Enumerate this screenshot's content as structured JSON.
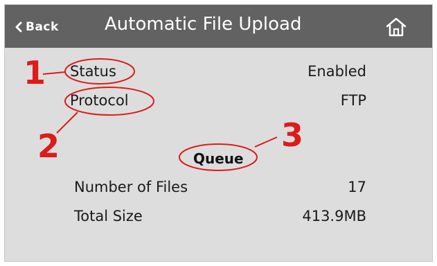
{
  "header": {
    "back_label": "Back",
    "title": "Automatic File Upload",
    "home_icon": "home-icon",
    "back_icon": "chevron-left-icon"
  },
  "settings": {
    "status": {
      "label": "Status",
      "value": "Enabled"
    },
    "protocol": {
      "label": "Protocol",
      "value": "FTP"
    }
  },
  "queue": {
    "heading": "Queue",
    "files": {
      "label": "Number of Files",
      "value": "17"
    },
    "size": {
      "label": "Total Size",
      "value": "413.9MB"
    }
  },
  "annotations": {
    "callout_1": "1",
    "callout_2": "2",
    "callout_3": "3",
    "color": "#dd1b1b"
  },
  "colors": {
    "header_bg": "#626262",
    "screen_bg": "#dddddd"
  }
}
